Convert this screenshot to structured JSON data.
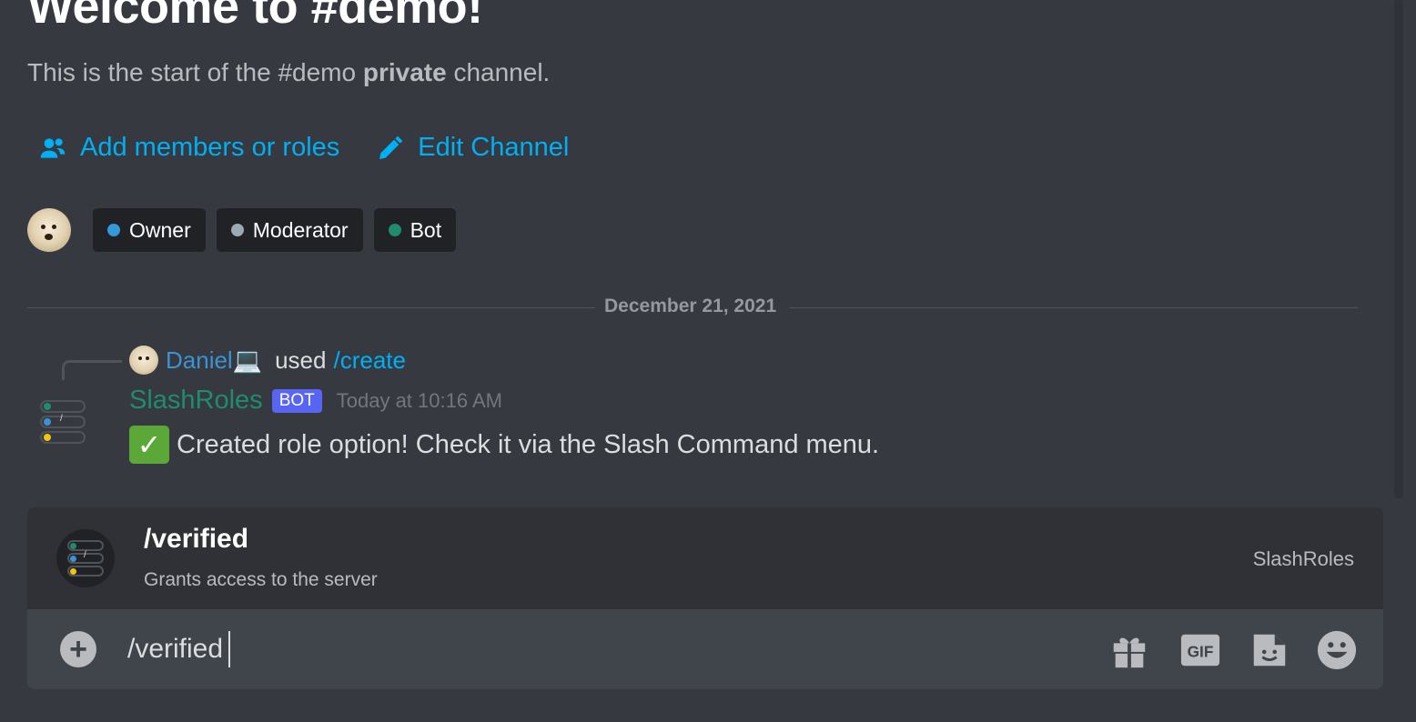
{
  "welcome": {
    "title": "Welcome to #demo!",
    "subtitle_before": "This is the start of the #demo ",
    "subtitle_bold": "private",
    "subtitle_after": " channel."
  },
  "actions": {
    "add_members": "Add members or roles",
    "edit_channel": "Edit Channel"
  },
  "roles": [
    {
      "label": "Owner",
      "color": "#3498db"
    },
    {
      "label": "Moderator",
      "color": "#99aab5"
    },
    {
      "label": "Bot",
      "color": "#1f8b6f"
    }
  ],
  "divider": {
    "date": "December 21, 2021"
  },
  "reply": {
    "user": "Daniel💻",
    "verb": "used",
    "command": "/create"
  },
  "message": {
    "author": "SlashRoles",
    "tag": "BOT",
    "timestamp": "Today at 10:16 AM",
    "emoji": "check-mark-button",
    "text": "Created role option! Check it via the Slash Command menu."
  },
  "autocomplete": {
    "command": "/verified",
    "description": "Grants access to the server",
    "app": "SlashRoles"
  },
  "composer": {
    "value": "/verified",
    "tools": [
      "gift-icon",
      "gif-icon",
      "sticker-icon",
      "emoji-icon"
    ],
    "gif_label": "GIF"
  },
  "colors": {
    "background": "#36393f",
    "link": "#00aff4",
    "bot_name": "#1f8b6f",
    "bot_tag": "#5865f2"
  }
}
